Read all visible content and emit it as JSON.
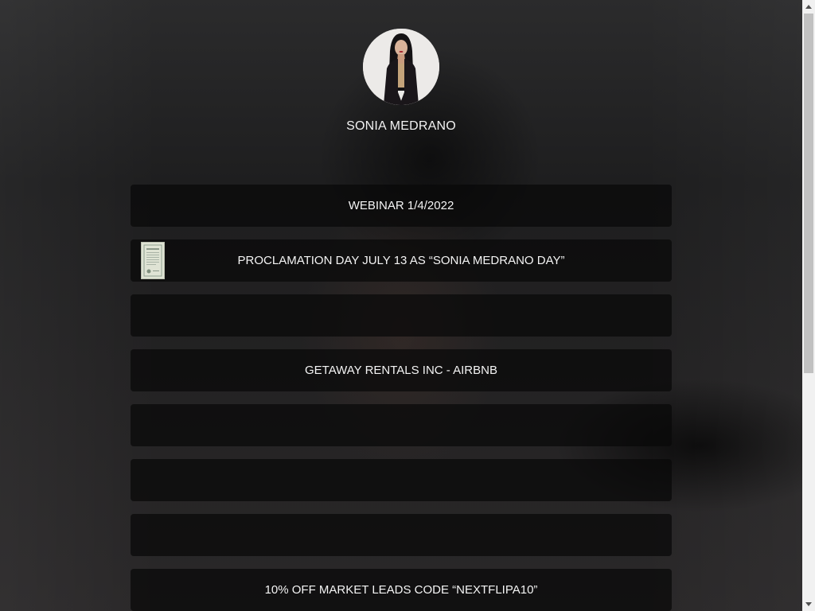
{
  "profile": {
    "name": "SONIA MEDRANO"
  },
  "links": [
    {
      "label": "WEBINAR 1/4/2022",
      "has_thumbnail": false
    },
    {
      "label": "PROCLAMATION DAY JULY 13 AS “SONIA MEDRANO DAY”",
      "has_thumbnail": true,
      "thumbnail_icon": "certificate-document-icon"
    },
    {
      "label": "",
      "has_thumbnail": false
    },
    {
      "label": "GETAWAY RENTALS INC - AIRBNB",
      "has_thumbnail": false
    },
    {
      "label": "",
      "has_thumbnail": false
    },
    {
      "label": "",
      "has_thumbnail": false
    },
    {
      "label": "",
      "has_thumbnail": false
    },
    {
      "label": "10% OFF MARKET LEADS CODE “NEXTFLIPA10”",
      "has_thumbnail": false
    }
  ],
  "scrollbar": {
    "up_icon": "scroll-up-arrow-icon",
    "down_icon": "scroll-down-arrow-icon"
  },
  "colors": {
    "background": "#2a2a2b",
    "button_bg": "#0d0d0d",
    "text": "#f4f4f4"
  }
}
